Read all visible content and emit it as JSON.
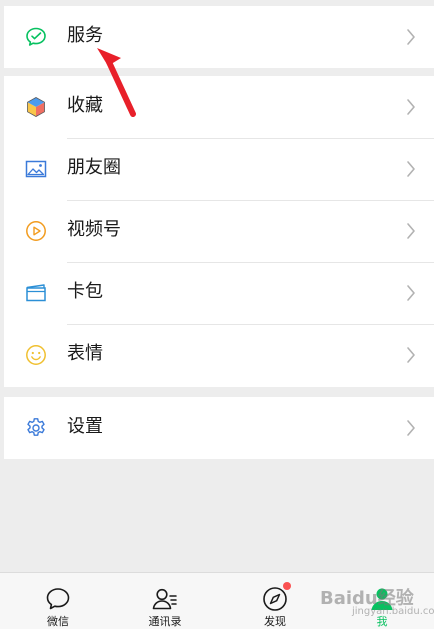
{
  "menu": {
    "groups": [
      {
        "items": [
          {
            "label": "服务",
            "icon": "service-wallet-icon"
          }
        ]
      },
      {
        "items": [
          {
            "label": "收藏",
            "icon": "favorites-cube-icon"
          },
          {
            "label": "朋友圈",
            "icon": "moments-image-icon"
          },
          {
            "label": "视频号",
            "icon": "channels-play-icon"
          },
          {
            "label": "卡包",
            "icon": "card-wallet-icon"
          },
          {
            "label": "表情",
            "icon": "sticker-smile-icon"
          }
        ]
      },
      {
        "items": [
          {
            "label": "设置",
            "icon": "settings-gear-icon"
          }
        ]
      }
    ]
  },
  "tabbar": {
    "tabs": [
      {
        "label": "微信",
        "icon": "chat-bubble-icon"
      },
      {
        "label": "通讯录",
        "icon": "contacts-icon"
      },
      {
        "label": "发现",
        "icon": "discover-compass-icon",
        "badge": true
      },
      {
        "label": "我",
        "icon": "me-person-icon",
        "active": true
      }
    ]
  },
  "watermark": {
    "main": "Baidu经验",
    "sub": "jingyan.baidu.com"
  },
  "colors": {
    "accent_green": "#07c160",
    "annotation_arrow": "#e8202a",
    "badge_red": "#fa5151",
    "background": "#ededed"
  }
}
